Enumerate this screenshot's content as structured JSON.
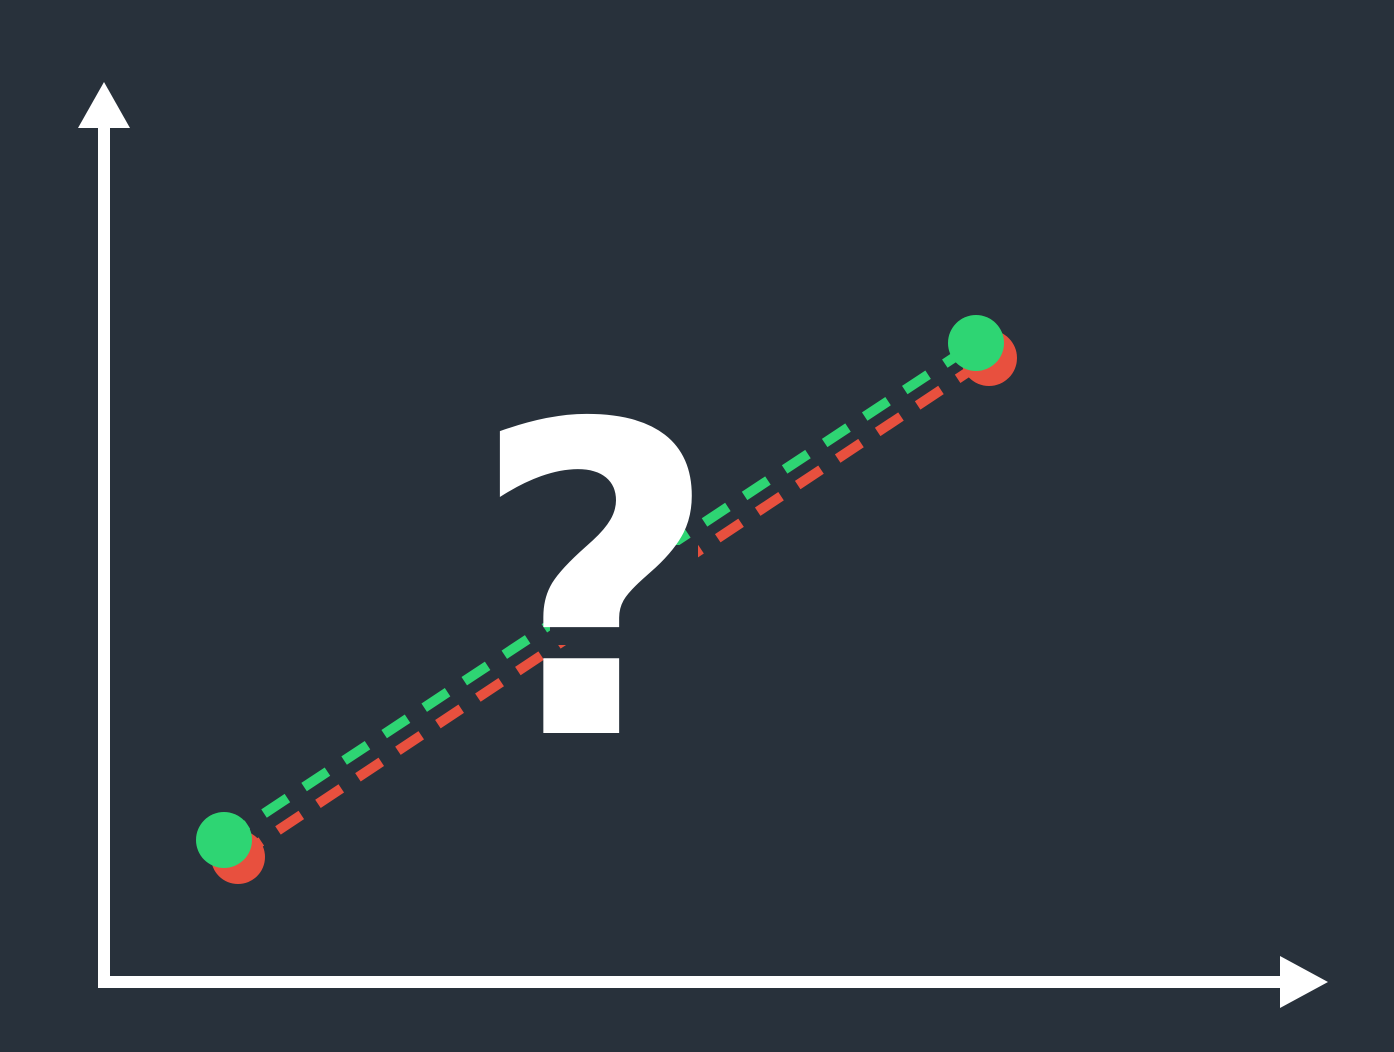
{
  "colors": {
    "background": "#28313b",
    "axis": "#ffffff",
    "green_line": "#2ed573",
    "red_line": "#e8503e",
    "symbol": "#ffffff"
  },
  "symbol": {
    "text": "?",
    "icon": "question-mark-icon"
  }
}
